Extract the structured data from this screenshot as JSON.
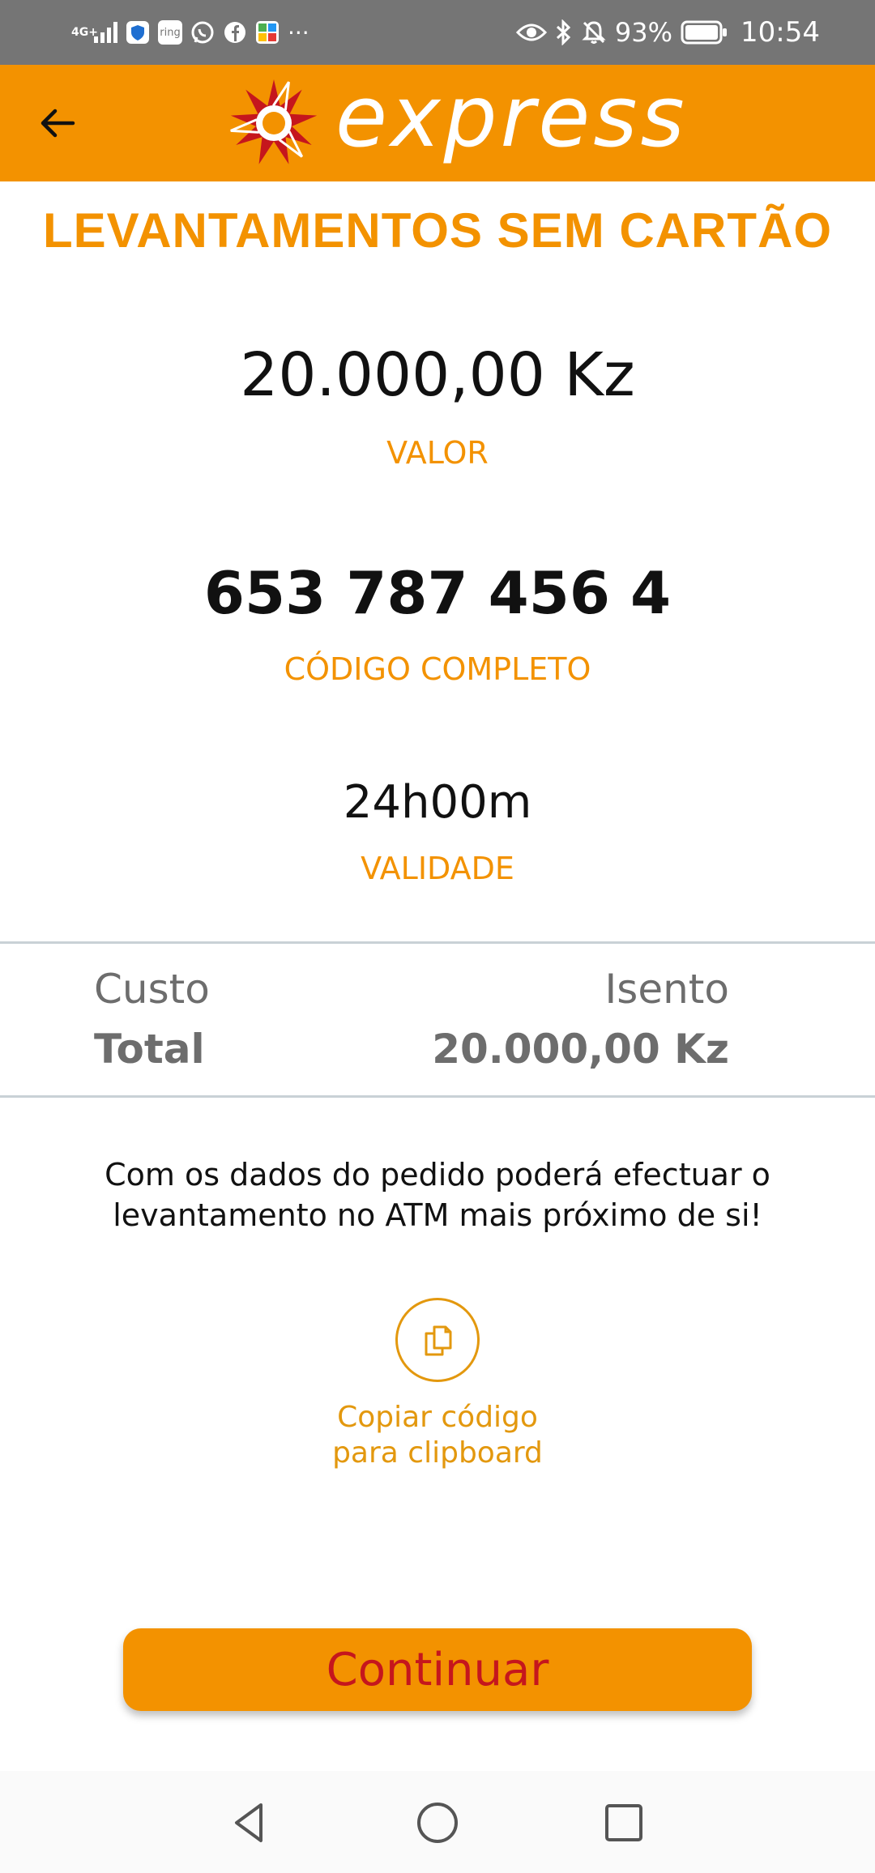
{
  "status_bar": {
    "network": "4G+",
    "battery": "93%",
    "time": "10:54",
    "app_icons": [
      "shield-icon",
      "ring-icon",
      "whatsapp-icon",
      "facebook-icon",
      "maps-icon"
    ],
    "ring_label": "ring",
    "more": "···"
  },
  "header": {
    "brand": "express"
  },
  "page": {
    "title": "LEVANTAMENTOS SEM CARTÃO",
    "amount": "20.000,00 Kz",
    "amount_label": "VALOR",
    "code": "653 787 456 4",
    "code_label": "CÓDIGO COMPLETO",
    "validity": "24h00m",
    "validity_label": "VALIDADE"
  },
  "summary": {
    "cost_label": "Custo",
    "cost_value": "Isento",
    "total_label": "Total",
    "total_value": "20.000,00 Kz"
  },
  "info_text": "Com os dados do pedido poderá efectuar o levantamento no ATM mais próximo de si!",
  "copy": {
    "line1": "Copiar código",
    "line2": "para clipboard"
  },
  "actions": {
    "continue_label": "Continuar"
  },
  "colors": {
    "brand_orange": "#f39200",
    "brand_red": "#c5161d",
    "status_bar": "#757575"
  }
}
